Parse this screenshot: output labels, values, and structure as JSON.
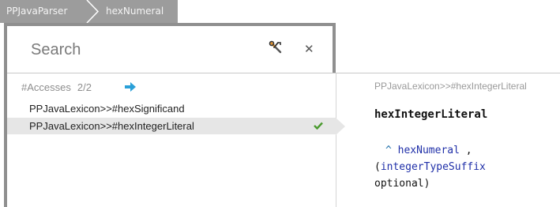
{
  "breadcrumb": {
    "items": [
      "PPJavaParser",
      "hexNumeral"
    ]
  },
  "search": {
    "placeholder": "Search",
    "value": ""
  },
  "results": {
    "label": "#Accesses",
    "count": "2/2",
    "items": [
      "PPJavaLexicon>>#hexSignificand",
      "PPJavaLexicon>>#hexIntegerLiteral"
    ],
    "selected_index": 1
  },
  "detail": {
    "title": "PPJavaLexicon>>#hexIntegerLiteral",
    "method_name": "hexIntegerLiteral",
    "caret": "^",
    "line1_ref": "hexNumeral",
    "line1_tail": " ,",
    "line2_open": "(",
    "line2_ref": "integerTypeSuffix",
    "line3": "optional)"
  },
  "colors": {
    "breadcrumb_bg": "#9c9c9c",
    "accent_blue": "#2aa0d8",
    "check_green": "#4a9a2e",
    "selected_row": "#e6e6e6"
  },
  "icons": [
    "tools-icon",
    "close-icon",
    "arrow-right-icon",
    "checkmark-icon"
  ]
}
